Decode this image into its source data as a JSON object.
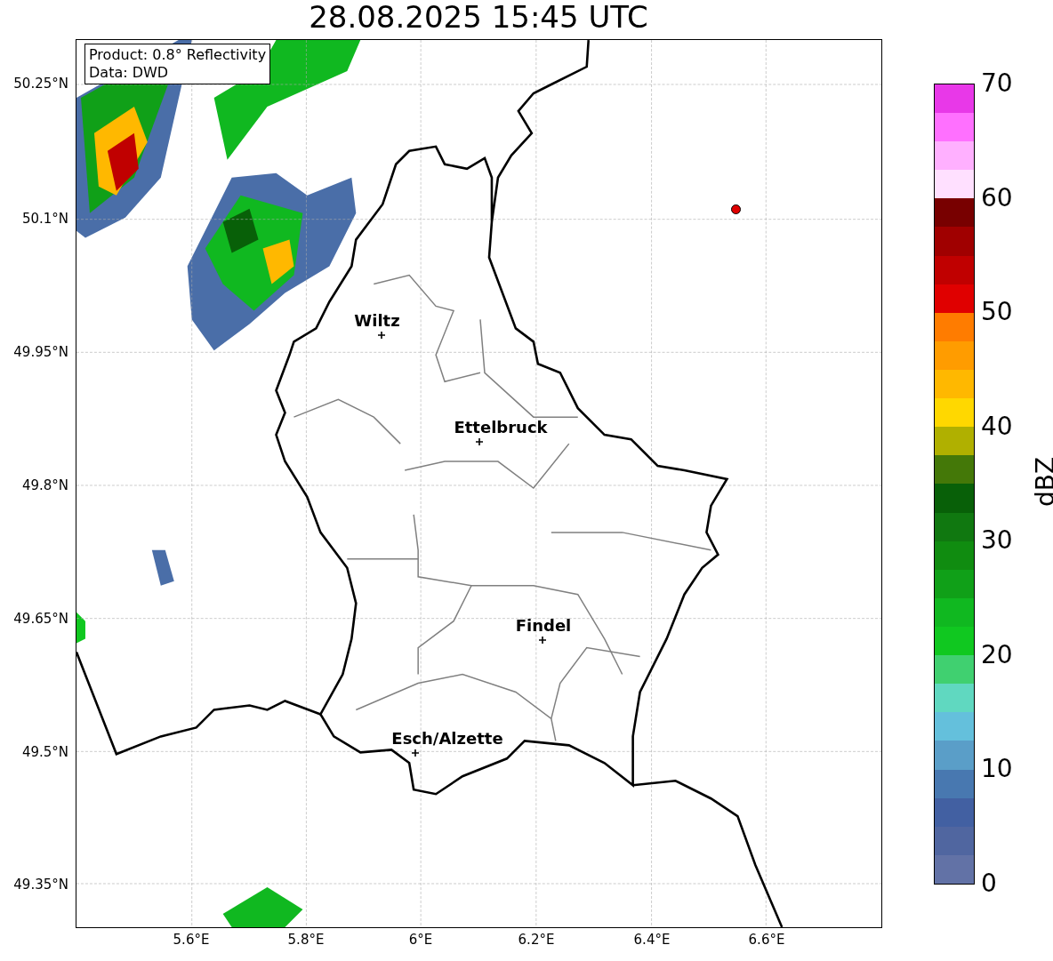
{
  "title": "28.08.2025 15:45 UTC",
  "info_box": [
    "Product: 0.8° Reflectivity",
    "Data: DWD"
  ],
  "lat_ticks": [
    "50.25°N",
    "50.1°N",
    "49.95°N",
    "49.8°N",
    "49.65°N",
    "49.5°N",
    "49.35°N"
  ],
  "lon_ticks": [
    "5.6°E",
    "5.8°E",
    "6°E",
    "6.2°E",
    "6.4°E",
    "6.6°E"
  ],
  "cities": [
    {
      "name": "Wiltz"
    },
    {
      "name": "Ettelbruck"
    },
    {
      "name": "Findel"
    },
    {
      "name": "Esch/Alzette"
    }
  ],
  "colorbar": {
    "label": "dBZ",
    "ticks": [
      "70",
      "60",
      "50",
      "40",
      "30",
      "20",
      "10",
      "0"
    ],
    "segments": [
      {
        "color": "#6272a6"
      },
      {
        "color": "#5066a0"
      },
      {
        "color": "#4260a2"
      },
      {
        "color": "#4878b0"
      },
      {
        "color": "#5a9ec8"
      },
      {
        "color": "#64c0dc"
      },
      {
        "color": "#60d8c0"
      },
      {
        "color": "#40d070"
      },
      {
        "color": "#10c820"
      },
      {
        "color": "#10b820"
      },
      {
        "color": "#10a018"
      },
      {
        "color": "#108c10"
      },
      {
        "color": "#107810"
      },
      {
        "color": "#086008"
      },
      {
        "color": "#447808"
      },
      {
        "color": "#b0b000"
      },
      {
        "color": "#ffd800"
      },
      {
        "color": "#ffb800"
      },
      {
        "color": "#ff9c00"
      },
      {
        "color": "#ff7c00"
      },
      {
        "color": "#e00000"
      },
      {
        "color": "#c00000"
      },
      {
        "color": "#a00000"
      },
      {
        "color": "#780000"
      },
      {
        "color": "#ffe0ff"
      },
      {
        "color": "#ffb0ff"
      },
      {
        "color": "#ff70ff"
      },
      {
        "color": "#e838e8"
      }
    ]
  }
}
